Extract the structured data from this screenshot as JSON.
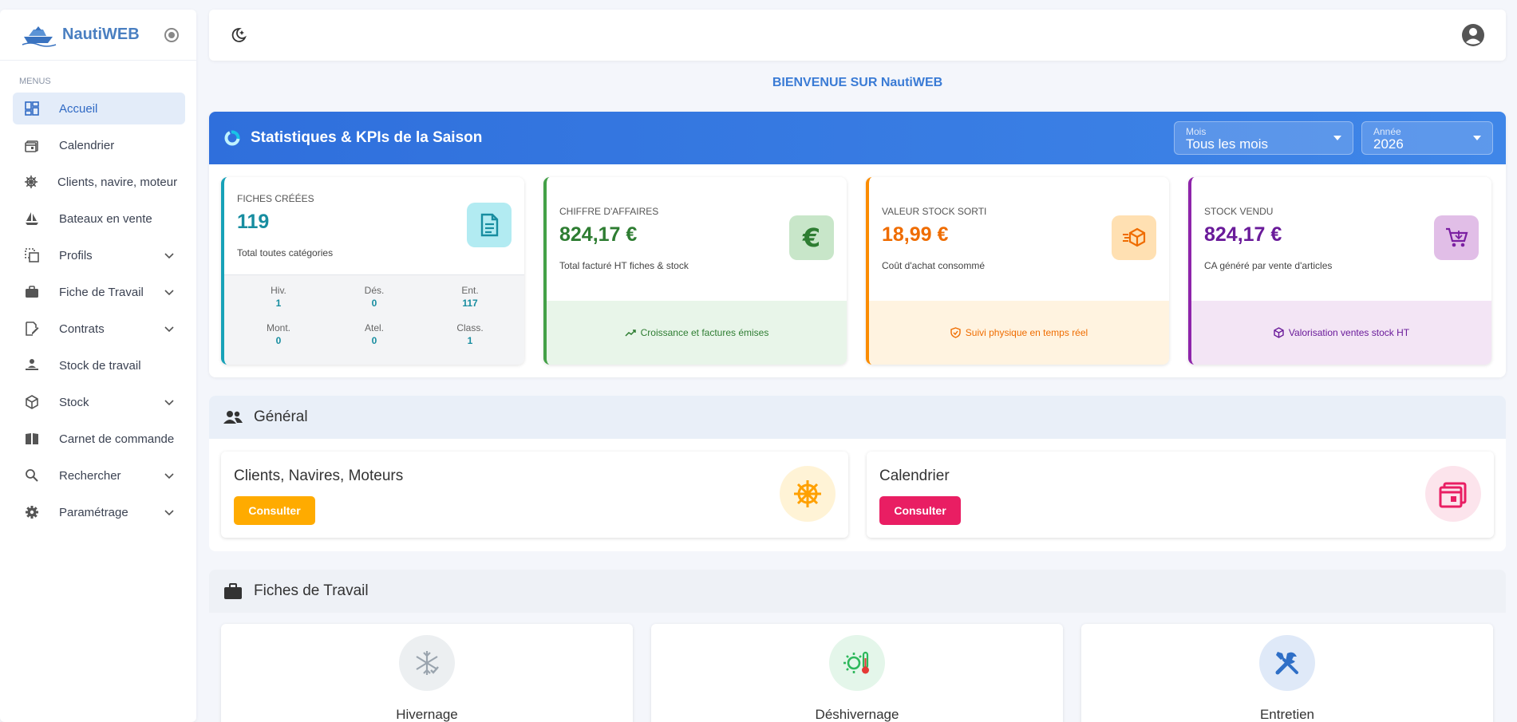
{
  "brand": {
    "name": "NautiWEB"
  },
  "sidebar": {
    "menu_title": "MENUS",
    "items": [
      {
        "label": "Accueil",
        "icon": "dashboard-icon",
        "active": true
      },
      {
        "label": "Calendrier",
        "icon": "calendar-icon"
      },
      {
        "label": "Clients, navire, moteur",
        "icon": "helm-icon"
      },
      {
        "label": "Bateaux en vente",
        "icon": "sailboat-icon"
      },
      {
        "label": "Profils",
        "icon": "profiles-icon",
        "expandable": true
      },
      {
        "label": "Fiche de Travail",
        "icon": "briefcase-icon",
        "expandable": true
      },
      {
        "label": "Contrats",
        "icon": "contract-icon",
        "expandable": true
      },
      {
        "label": "Stock de travail",
        "icon": "worker-icon"
      },
      {
        "label": "Stock",
        "icon": "box-icon",
        "expandable": true
      },
      {
        "label": "Carnet de commande",
        "icon": "book-icon"
      },
      {
        "label": "Rechercher",
        "icon": "search-icon",
        "expandable": true
      },
      {
        "label": "Paramétrage",
        "icon": "gear-icon",
        "expandable": true
      }
    ]
  },
  "header": {
    "welcome": "BIENVENUE SUR NautiWEB"
  },
  "kpi": {
    "title": "Statistiques & KPIs de la Saison",
    "month": {
      "label": "Mois",
      "value": "Tous les mois"
    },
    "year": {
      "label": "Année",
      "value": "2026"
    },
    "cards": [
      {
        "label": "FICHES CRÉÉES",
        "value": "119",
        "sub": "Total toutes catégories",
        "color": "#17a2b8"
      },
      {
        "label": "CHIFFRE D'AFFAIRES",
        "value": "824,17 €",
        "sub": "Total facturé HT fiches & stock",
        "footer": "Croissance et factures émises",
        "color": "#2e7d32"
      },
      {
        "label": "VALEUR STOCK SORTI",
        "value": "18,99 €",
        "sub": "Coût d'achat consommé",
        "footer": "Suivi physique en temps réel",
        "color": "#ef6c00"
      },
      {
        "label": "STOCK VENDU",
        "value": "824,17 €",
        "sub": "CA généré par vente d'articles",
        "footer": "Valorisation ventes stock HT",
        "color": "#6a1b9a"
      }
    ],
    "breakdown": [
      {
        "label": "Hiv.",
        "value": "1"
      },
      {
        "label": "Dés.",
        "value": "0"
      },
      {
        "label": "Ent.",
        "value": "117"
      },
      {
        "label": "Mont.",
        "value": "0"
      },
      {
        "label": "Atel.",
        "value": "0"
      },
      {
        "label": "Class.",
        "value": "1"
      }
    ]
  },
  "general": {
    "title": "Général",
    "cards": [
      {
        "title": "Clients, Navires, Moteurs",
        "button": "Consulter",
        "color": "#ffab00"
      },
      {
        "title": "Calendrier",
        "button": "Consulter",
        "color": "#e91e63"
      }
    ]
  },
  "fiches": {
    "title": "Fiches de Travail",
    "cards": [
      {
        "title": "Hivernage",
        "icon": "snowflake-icon"
      },
      {
        "title": "Déshivernage",
        "icon": "thermometer-sun-icon"
      },
      {
        "title": "Entretien",
        "icon": "tools-icon"
      }
    ]
  }
}
